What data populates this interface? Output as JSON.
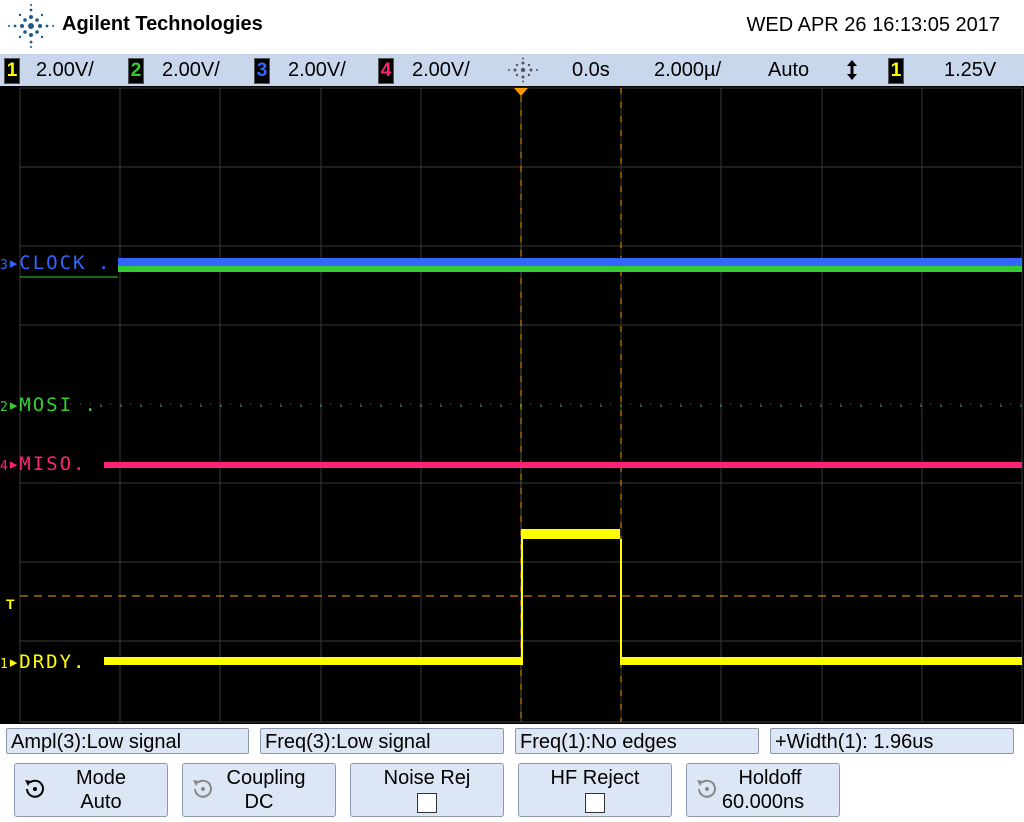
{
  "header": {
    "brand": "Agilent Technologies",
    "datetime": "WED APR 26 16:13:05 2017"
  },
  "status_bar": {
    "channels": [
      {
        "num": "1",
        "scale": "2.00V/",
        "color": "#ffff00"
      },
      {
        "num": "2",
        "scale": "2.00V/",
        "color": "#33cc33"
      },
      {
        "num": "3",
        "scale": "2.00V/",
        "color": "#3366ff"
      },
      {
        "num": "4",
        "scale": "2.00V/",
        "color": "#ff2277"
      }
    ],
    "time_offset": "0.0s",
    "timebase": "2.000µ/",
    "trigger_mode": "Auto",
    "trigger_slope_icon": "updown-arrows-icon",
    "trigger_channel": "1",
    "trigger_level": "1.25V"
  },
  "traces": [
    {
      "num": "3",
      "label": "CLOCK",
      "color": "#3366ff"
    },
    {
      "num": "2",
      "label": "MOSI",
      "color": "#33cc33"
    },
    {
      "num": "4",
      "label": "MISO",
      "color": "#ff2277"
    },
    {
      "num": "1",
      "label": "DRDY",
      "color": "#ffff00"
    }
  ],
  "trigger_marker": "T",
  "measurements": [
    "Ampl(3):Low signal",
    "Freq(3):Low signal",
    "Freq(1):No edges",
    "+Width(1): 1.96us"
  ],
  "softkeys": {
    "mode": {
      "label": "Mode",
      "value": "Auto"
    },
    "coupling": {
      "label": "Coupling",
      "value": "DC"
    },
    "noise_rej": {
      "label": "Noise Rej"
    },
    "hf_reject": {
      "label": "HF Reject"
    },
    "holdoff": {
      "label": "Holdoff",
      "value": "60.000ns"
    }
  }
}
